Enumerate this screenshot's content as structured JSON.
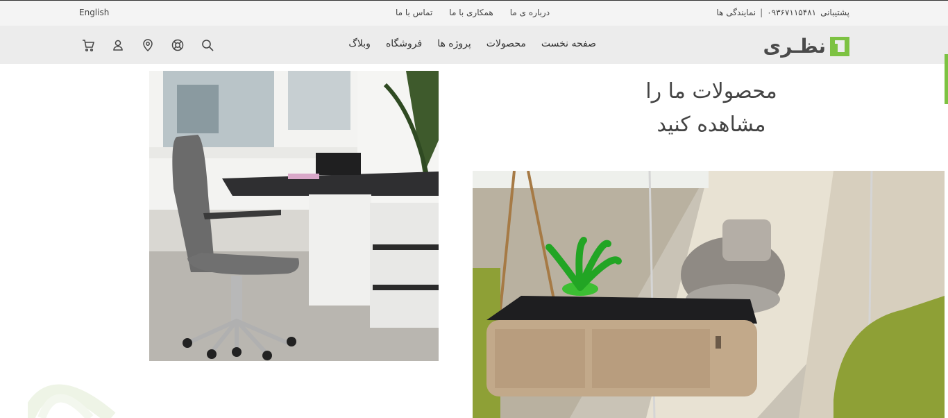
{
  "topbar": {
    "language": "English",
    "links": [
      "درباره ی ما",
      "همکاری با ما",
      "تماس با ما"
    ],
    "support_label": "پشتیبانی",
    "support_phone": "۰۹۳۶۷۱۱۵۴۸۱",
    "separator": "|",
    "agencies": "نمایندگی ها"
  },
  "logo": {
    "text": "نظـری"
  },
  "nav": {
    "items": [
      "صفحه نخست",
      "محصولات",
      "پروژه ها",
      "فروشگاه",
      "وبلاگ"
    ]
  },
  "icons": [
    "cart-icon",
    "user-icon",
    "location-icon",
    "support-icon",
    "search-icon"
  ],
  "hero": {
    "line1": "محصولات ما را",
    "line2": "مشاهده کنید"
  },
  "colors": {
    "accent": "#7dc242",
    "topbar_bg": "#f4f4f4",
    "navbar_bg": "#ececec"
  }
}
